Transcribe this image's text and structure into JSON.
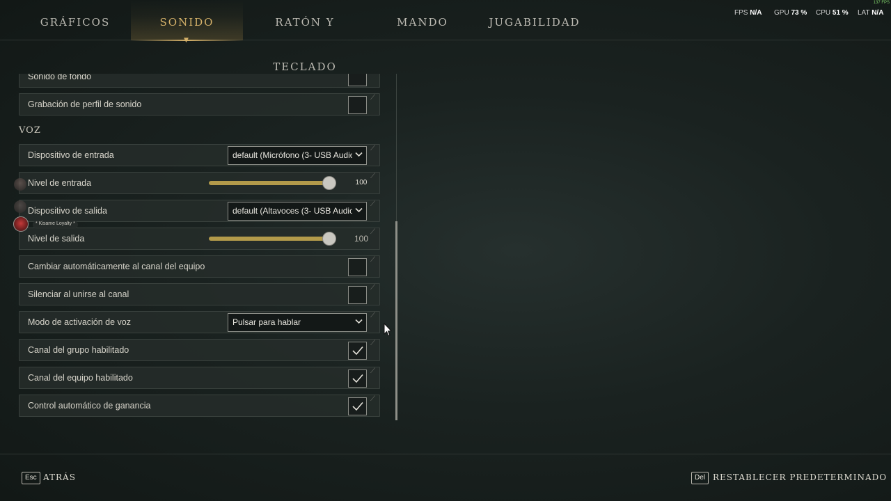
{
  "nav": {
    "tabs": [
      {
        "label": "GRÁFICOS"
      },
      {
        "label": "SONIDO"
      },
      {
        "label": "RATÓN Y TECLADO"
      },
      {
        "label": "MANDO"
      },
      {
        "label": "JUGABILIDAD"
      }
    ],
    "active_tab": "SONIDO"
  },
  "perf": {
    "fps_label": "FPS",
    "fps_value": "N/A",
    "gpu_label": "GPU",
    "gpu_value": "73 %",
    "cpu_label": "CPU",
    "cpu_value": "51 %",
    "lat_label": "LAT",
    "lat_value": "N/A",
    "corner_fps": "137 FPS"
  },
  "settings": {
    "background_sound_label": "Sonido de fondo",
    "background_sound_checked": false,
    "sound_profile_label": "Grabación de perfil de sonido",
    "sound_profile_checked": false,
    "voice_section": "VOZ",
    "input_device_label": "Dispositivo de entrada",
    "input_device_value": "default (Micrófono (3- USB Audio",
    "input_level_label": "Nivel de entrada",
    "input_level_value": "100",
    "input_level_fraction": 1.0,
    "output_device_label": "Dispositivo de salida",
    "output_device_value": "default (Altavoces (3- USB Audio",
    "output_level_label": "Nivel de salida",
    "output_level_value": "100",
    "output_level_fraction": 1.0,
    "auto_team_channel_label": "Cambiar automáticamente al canal del equipo",
    "auto_team_channel_checked": false,
    "mute_on_join_label": "Silenciar al unirse al canal",
    "mute_on_join_checked": false,
    "voice_mode_label": "Modo de activación de voz",
    "voice_mode_value": "Pulsar para hablar",
    "group_channel_label": "Canal del grupo habilitado",
    "group_channel_checked": true,
    "team_channel_label": "Canal del equipo habilitado",
    "team_channel_checked": true,
    "agc_label": "Control automático de ganancia",
    "agc_checked": true
  },
  "overlay": {
    "user_tag": "* Kisame Loyalty *"
  },
  "footer": {
    "back_key": "Esc",
    "back_label": "ATRÁS",
    "reset_key": "Del",
    "reset_label": "RESTABLECER PREDETERMINADO"
  },
  "colors": {
    "accent_gold": "#d6b26a",
    "slider_fill": "#b39a4a",
    "perf_good": "#7fd06a"
  }
}
